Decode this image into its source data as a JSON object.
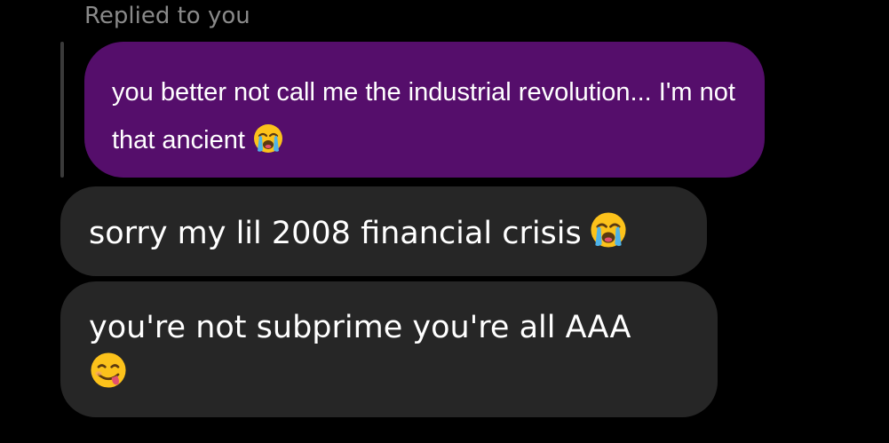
{
  "thread": {
    "reply_label": "Replied to you",
    "quoted_message": {
      "text": "you better not call me the industrial revolution... I'm not that ancient",
      "emoji": "loudly-crying-face",
      "bubble_color": "#550e6b"
    },
    "messages": [
      {
        "text": "sorry my lil 2008 financial crisis",
        "emoji": "loudly-crying-face",
        "bubble_color": "#262626"
      },
      {
        "text": "you're not subprime you're all AAA",
        "emoji": "face-savoring-food",
        "bubble_color": "#262626"
      }
    ]
  },
  "colors": {
    "background": "#000000",
    "label": "#8a8a8a",
    "reply_bar": "#3a3a3a",
    "text": "#ffffff"
  }
}
